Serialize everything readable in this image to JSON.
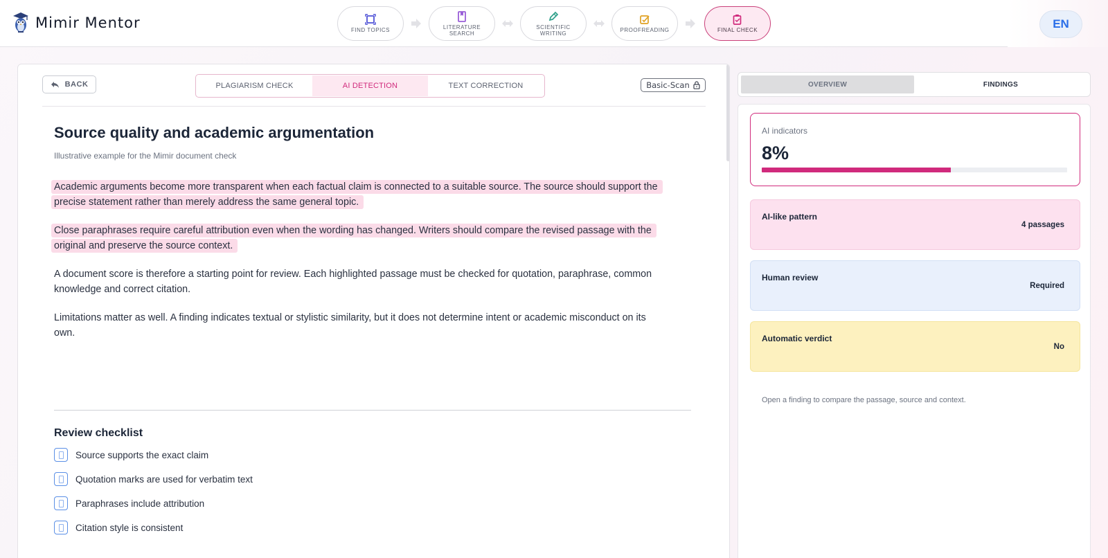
{
  "app": {
    "name": "Mimir Mentor"
  },
  "steps": [
    {
      "label": "Find Topics",
      "icon": "target-icon",
      "color": "#4f52d6"
    },
    {
      "label": "Literature Search",
      "icon": "bookmark-icon",
      "color": "#9a5fd8"
    },
    {
      "label": "Scientific Writing",
      "icon": "pen-icon",
      "color": "#2fa08a"
    },
    {
      "label": "Proofreading",
      "icon": "checklist-icon",
      "color": "#e0a122"
    },
    {
      "label": "Final Check",
      "icon": "clipboard-icon",
      "color": "#d02a7c",
      "active": true
    }
  ],
  "language": "EN",
  "toolbar": {
    "back_label": "BACK",
    "tabs": [
      "PLAGIARISM CHECK",
      "AI DETECTION",
      "TEXT CORRECTION"
    ],
    "active_tab": "AI DETECTION",
    "plan_badge": "Basic-Scan"
  },
  "document": {
    "title": "Source quality and academic argumentation",
    "subtitle": "Illustrative example for the Mimir document check",
    "paragraphs": [
      {
        "text": "Academic arguments become more transparent when each factual claim is connected to a suitable source. The source should support the precise statement rather than merely address the same general topic.",
        "highlighted": true
      },
      {
        "text": "Close paraphrases require careful attribution even when the wording has changed. Writers should compare the revised passage with the original and preserve the source context.",
        "highlighted": true
      },
      {
        "text": "A document score is therefore a starting point for review. Each highlighted passage must be checked for quotation, paraphrase, common knowledge and correct citation.",
        "highlighted": false
      },
      {
        "text": "Limitations matter as well. A finding indicates textual or stylistic similarity, but it does not determine intent or academic misconduct on its own.",
        "highlighted": false
      }
    ]
  },
  "checklist": {
    "title": "Review checklist",
    "items": [
      "Source supports the exact claim",
      "Quotation marks are used for verbatim text",
      "Paraphrases include attribution",
      "Citation style is consistent"
    ]
  },
  "sidebar": {
    "tabs": [
      "OVERVIEW",
      "FINDINGS"
    ],
    "active_tab": "OVERVIEW",
    "ai_indicators": {
      "label": "AI indicators",
      "value": "8%",
      "bar_fraction": 0.62,
      "color": "#d02a7c"
    },
    "metrics": [
      {
        "label": "AI-like pattern",
        "value": "4 passages",
        "tone": "pink"
      },
      {
        "label": "Human review",
        "value": "Required",
        "tone": "blue"
      },
      {
        "label": "Automatic verdict",
        "value": "No",
        "tone": "yellow"
      }
    ],
    "hint": "Open a finding to compare the passage, source and context."
  }
}
